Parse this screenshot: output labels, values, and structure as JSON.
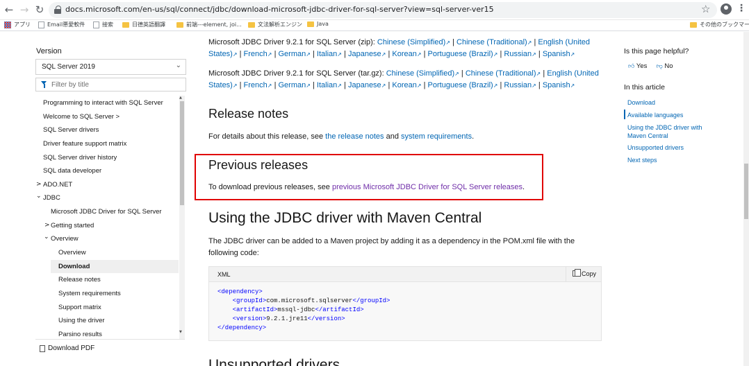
{
  "browser": {
    "url": "docs.microsoft.com/en-us/sql/connect/jdbc/download-microsoft-jdbc-driver-for-sql-server?view=sql-server-ver15",
    "bookmarks": [
      "アプリ",
      "Email悪愛軟件",
      "接索",
      "日德英語翻譯",
      "前端---element, joi...",
      "文法解析エンジン",
      "Java"
    ],
    "other_bookmarks": "その他のブックマーク"
  },
  "sidebar": {
    "version_label": "Version",
    "version_value": "SQL Server 2019",
    "filter_placeholder": "Filter by title",
    "toc": [
      {
        "label": "Programming to interact with SQL Server",
        "level": 1
      },
      {
        "label": "Welcome to SQL Server >",
        "level": 1
      },
      {
        "label": "SQL Server drivers",
        "level": 1
      },
      {
        "label": "Driver feature support matrix",
        "level": 1
      },
      {
        "label": "SQL Server driver history",
        "level": 1
      },
      {
        "label": "SQL data developer",
        "level": 1
      },
      {
        "label": "ADO.NET",
        "level": 1,
        "chevron": ">"
      },
      {
        "label": "JDBC",
        "level": 1,
        "chevron": "⌄"
      },
      {
        "label": "Microsoft JDBC Driver for SQL Server",
        "level": 2
      },
      {
        "label": "Getting started",
        "level": 2,
        "chevron": ">"
      },
      {
        "label": "Overview",
        "level": 2,
        "chevron": "⌄"
      },
      {
        "label": "Overview",
        "level": 3
      },
      {
        "label": "Download",
        "level": 3,
        "selected": true
      },
      {
        "label": "Release notes",
        "level": 3
      },
      {
        "label": "System requirements",
        "level": 3
      },
      {
        "label": "Support matrix",
        "level": 3
      },
      {
        "label": "Using the driver",
        "level": 3
      },
      {
        "label": "Parsino results",
        "level": 3
      }
    ],
    "download_pdf": "Download PDF"
  },
  "main": {
    "zip": {
      "prefix": "Microsoft JDBC Driver 9.2.1 for SQL Server (zip):",
      "links": [
        "Chinese (Simplified)",
        "Chinese (Traditional)",
        "English (United States)",
        "French",
        "German",
        "Italian",
        "Japanese",
        "Korean",
        "Portuguese (Brazil)",
        "Russian",
        "Spanish"
      ]
    },
    "targz": {
      "prefix": "Microsoft JDBC Driver 9.2.1 for SQL Server (tar.gz):",
      "links": [
        "Chinese (Simplified)",
        "Chinese (Traditional)",
        "English (United States)",
        "French",
        "German",
        "Italian",
        "Japanese",
        "Korean",
        "Portuguese (Brazil)",
        "Russian",
        "Spanish"
      ]
    },
    "release_notes": {
      "heading": "Release notes",
      "t1": "For details about this release, see ",
      "link1": "the release notes",
      "t2": " and ",
      "link2": "system requirements",
      "t3": "."
    },
    "previous": {
      "heading": "Previous releases",
      "t1": "To download previous releases, see ",
      "link": "previous Microsoft JDBC Driver for SQL Server releases",
      "t2": "."
    },
    "maven": {
      "heading": "Using the JDBC driver with Maven Central",
      "text": "The JDBC driver can be added to a Maven project by adding it as a dependency in the POM.xml file with the following code:"
    },
    "code": {
      "lang": "XML",
      "copy_label": "Copy",
      "groupId": "com.microsoft.sqlserver",
      "artifactId": "mssql-jdbc",
      "version": "9.2.1.jre11"
    },
    "next_heading": "Unsupported drivers"
  },
  "rail": {
    "helpful": "Is this page helpful?",
    "yes": "Yes",
    "no": "No",
    "in_article": "In this article",
    "links": [
      "Download",
      "Available languages",
      "Using the JDBC driver with Maven Central",
      "Unsupported drivers",
      "Next steps"
    ]
  }
}
